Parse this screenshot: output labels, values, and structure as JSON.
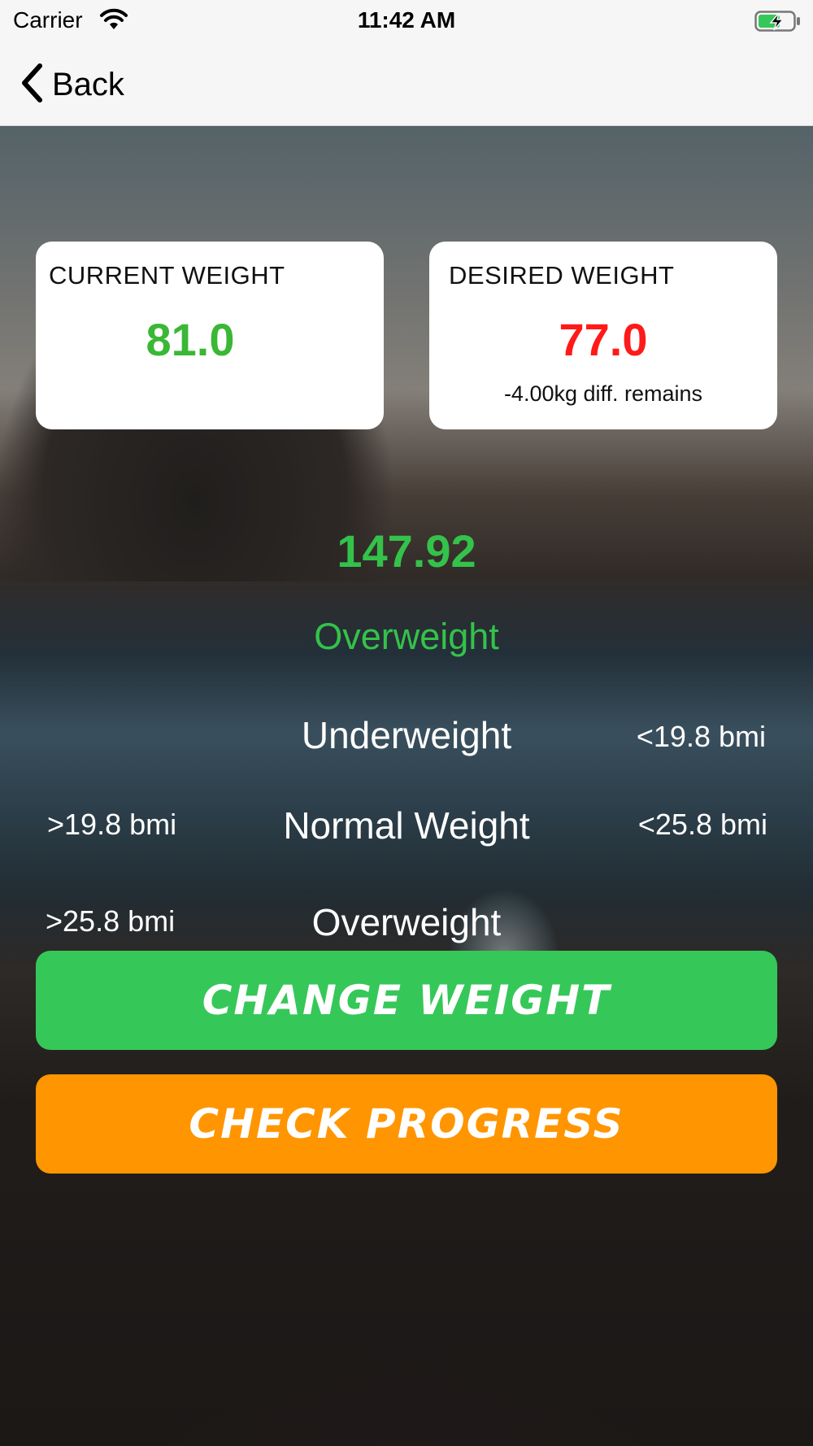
{
  "status_bar": {
    "carrier": "Carrier",
    "time": "11:42 AM"
  },
  "nav": {
    "back_label": "Back"
  },
  "current_weight": {
    "title": "CURRENT WEIGHT",
    "value": "81.0",
    "color": "#3ab735"
  },
  "desired_weight": {
    "title": "DESIRED WEIGHT",
    "value": "77.0",
    "note": "-4.00kg diff. remains",
    "color": "#ff1a1a"
  },
  "bmi": {
    "value": "147.92",
    "category": "Overweight",
    "color": "#34c24a"
  },
  "ranges": [
    {
      "label": "Underweight",
      "min": "",
      "max": "<19.8 bmi"
    },
    {
      "label": "Normal Weight",
      "min": ">19.8 bmi",
      "max": "<25.8 bmi"
    },
    {
      "label": "Overweight",
      "min": ">25.8 bmi",
      "max": ""
    }
  ],
  "buttons": {
    "change_weight": {
      "label": "CHANGE WEIGHT",
      "color": "#36c759"
    },
    "check_progress": {
      "label": "CHECK PROGRESS",
      "color": "#ff9500"
    }
  }
}
